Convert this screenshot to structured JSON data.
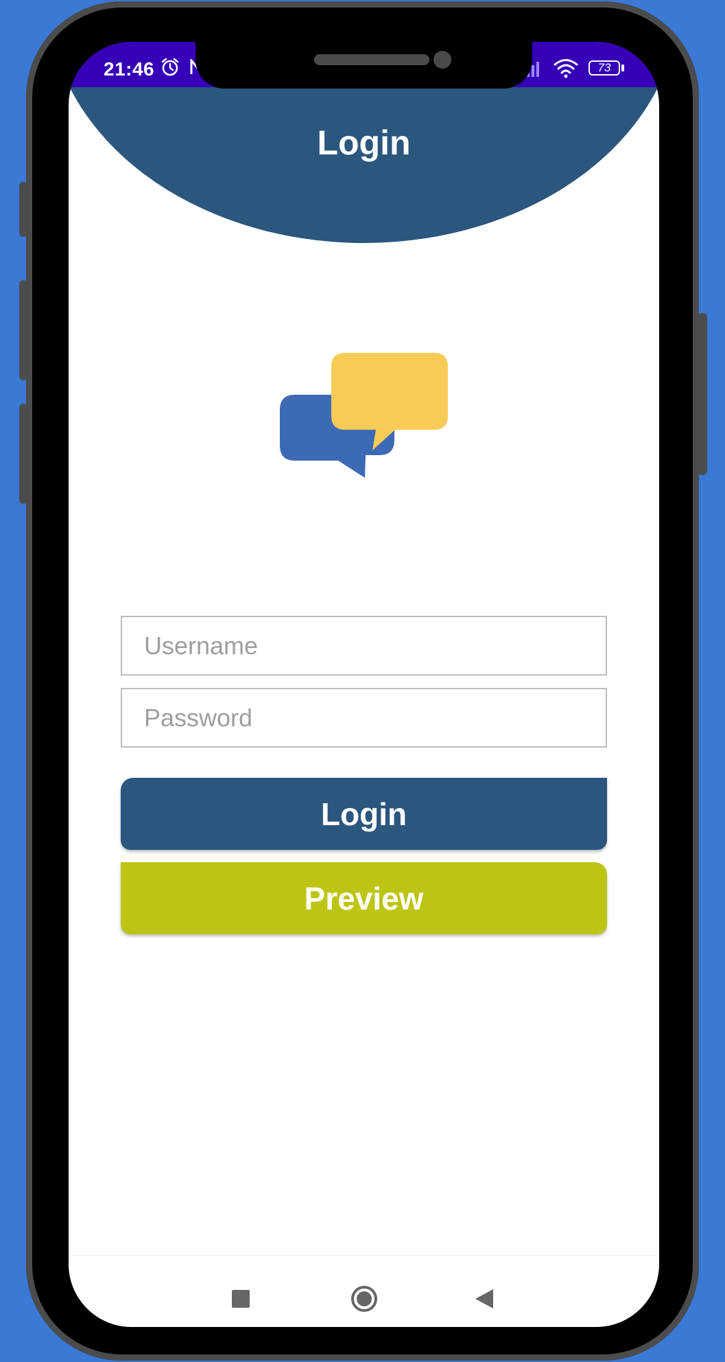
{
  "status_bar": {
    "time": "21:46",
    "battery_level": "73",
    "background_color": "#3600b8",
    "icons": [
      "alarm-icon",
      "notification-icon",
      "signal-icon",
      "wifi-icon",
      "battery-icon"
    ]
  },
  "header": {
    "title": "Login",
    "color": "#2b567e"
  },
  "logo": {
    "icon": "chat-bubbles-icon",
    "colors": [
      "#3d6ab4",
      "#f8cb57"
    ]
  },
  "form": {
    "username": {
      "value": "",
      "placeholder": "Username"
    },
    "password": {
      "value": "",
      "placeholder": "Password"
    }
  },
  "buttons": {
    "login": {
      "label": "Login",
      "color": "#2b567e"
    },
    "preview": {
      "label": "Preview",
      "color": "#bcc513"
    }
  },
  "nav_bar": {
    "icons": [
      "recents-square-icon",
      "home-circle-icon",
      "back-triangle-icon"
    ]
  }
}
